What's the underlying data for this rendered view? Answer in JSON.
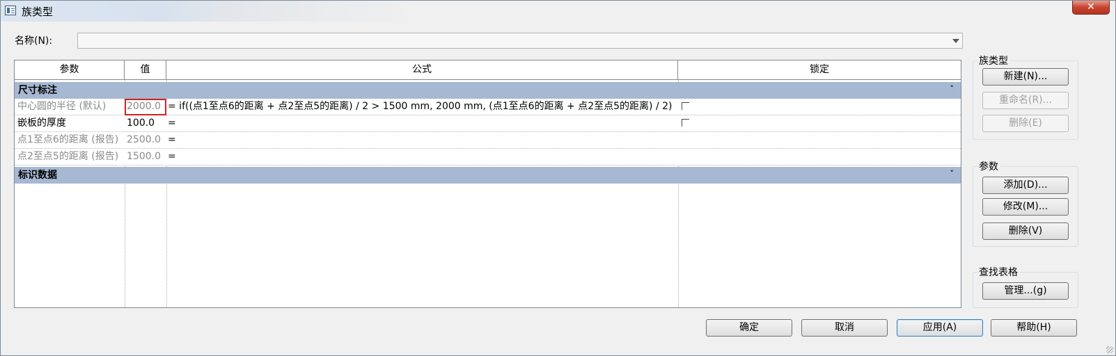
{
  "window": {
    "title": "族类型",
    "close_label": "✕"
  },
  "name_field": {
    "label": "名称(N):",
    "value": ""
  },
  "grid": {
    "columns": [
      "参数",
      "值",
      "公式",
      "锁定"
    ],
    "groups": [
      {
        "label": "尺寸标注",
        "chevron": "˄",
        "rows": [
          {
            "param": "中心圆的半径 (默认)",
            "value": "2000.0",
            "formula": "= if((点1至点6的距离 + 点2至点5的距离) / 2 > 1500 mm, 2000 mm, (点1至点6的距离 + 点2至点5的距离) / 2)",
            "lock": true
          },
          {
            "param": "嵌板的厚度",
            "value": "100.0",
            "formula": "=",
            "lock": true
          },
          {
            "param": "点1至点6的距离 (报告)",
            "value": "2500.0",
            "formula": "=",
            "lock": false
          },
          {
            "param": "点2至点5的距离 (报告)",
            "value": "1500.0",
            "formula": "=",
            "lock": false
          }
        ]
      },
      {
        "label": "标识数据",
        "chevron": "˅",
        "rows": []
      }
    ]
  },
  "family_types": {
    "title": "族类型",
    "new_label": "新建(N)...",
    "rename_label": "重命名(R)...",
    "delete_label": "删除(E)"
  },
  "parameters": {
    "title": "参数",
    "add_label": "添加(D)...",
    "modify_label": "修改(M)...",
    "delete_label": "删除(V)"
  },
  "lookup_tables": {
    "title": "查找表格",
    "manage_label": "管理...(g)"
  },
  "footer": {
    "ok_label": "确定",
    "cancel_label": "取消",
    "apply_label": "应用(A)",
    "help_label": "帮助(H)"
  }
}
